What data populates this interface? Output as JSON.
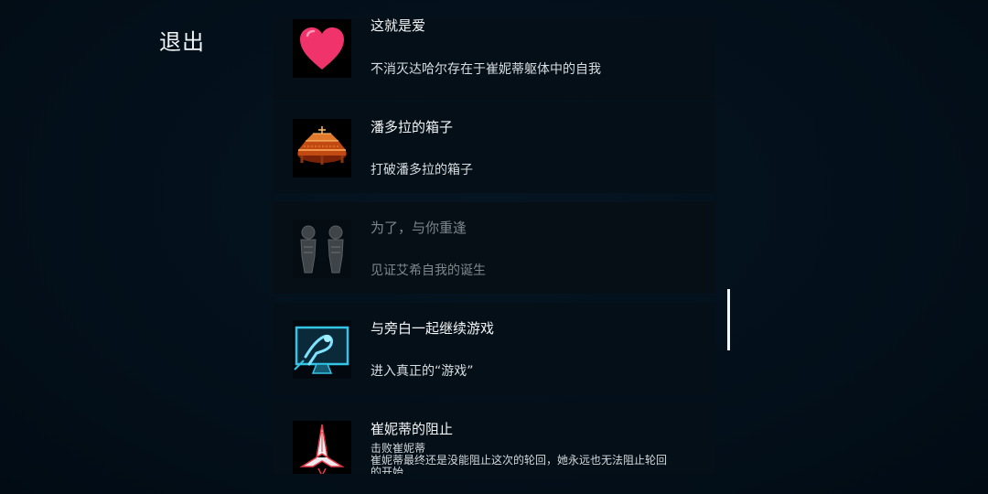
{
  "exit_label": "退出",
  "achievements": [
    {
      "title": "这就是爱",
      "desc": "不消灭达哈尔存在于崔妮蒂躯体中的自我",
      "icon": "heart-icon",
      "locked": false
    },
    {
      "title": "潘多拉的箱子",
      "desc": "打破潘多拉的箱子",
      "icon": "pandora-box-icon",
      "locked": false
    },
    {
      "title": "为了，与你重逢",
      "desc": "见证艾希自我的诞生",
      "icon": "twin-figures-icon",
      "locked": true
    },
    {
      "title": "与旁白一起继续游戏",
      "desc": "进入真正的“游戏”",
      "icon": "monitor-figure-icon",
      "locked": false
    },
    {
      "title": "崔妮蒂的阻止",
      "desc": "击败崔妮蒂",
      "desc2": "崔妮蒂最终还是没能阻止这次的轮回，她永远也无法阻止轮回",
      "desc3": "的开始",
      "icon": "spaceship-icon",
      "locked": false
    }
  ],
  "colors": {
    "accent_heart": "#f0336a",
    "box_orange": "#e0641c",
    "monitor_cyan": "#33c4e6",
    "ship_red": "#e23a44"
  }
}
